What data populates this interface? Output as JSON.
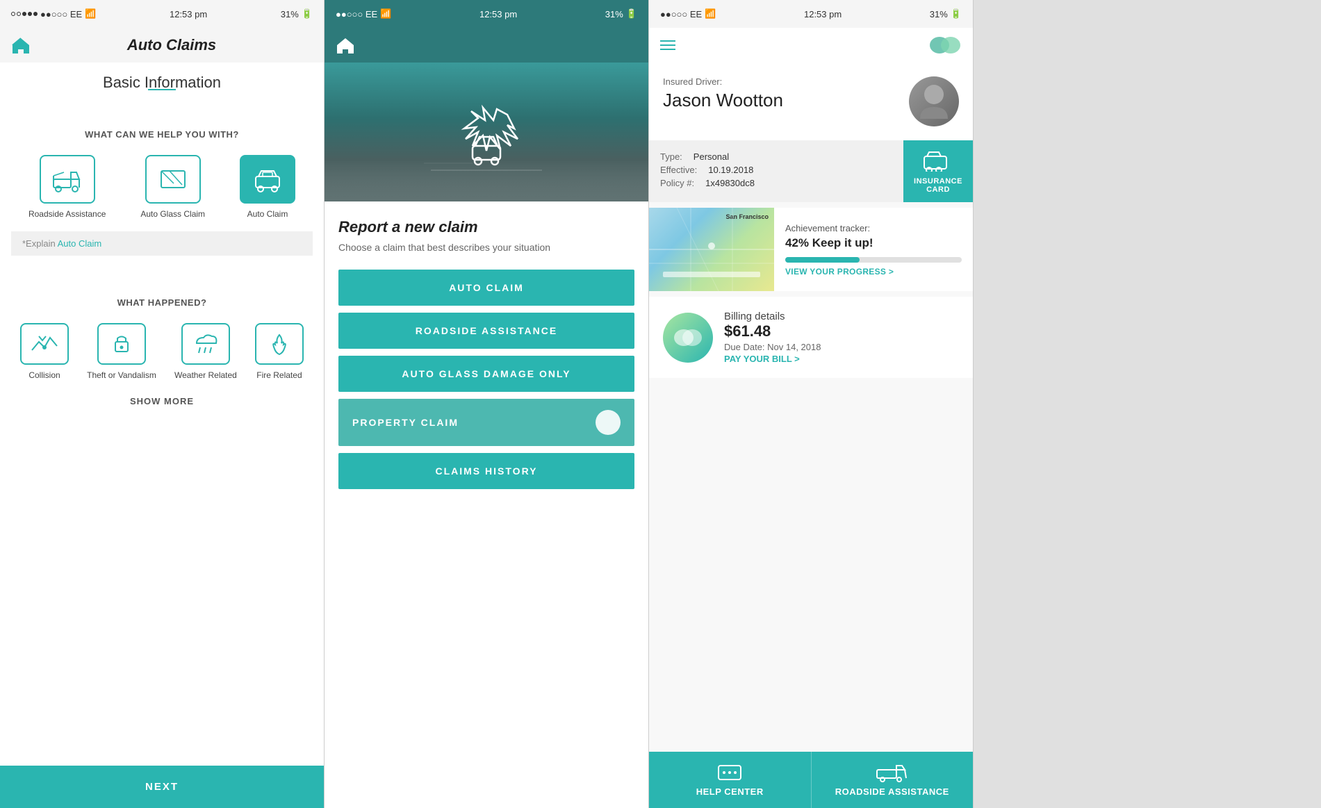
{
  "phones": [
    {
      "id": "phone1",
      "statusBar": {
        "left": "●●○○○ EE",
        "time": "12:53 pm",
        "right": "31%"
      },
      "navTitle": "Auto Claims",
      "basicInfoTitle": "Basic Information",
      "helpSection": {
        "title": "WHAT CAN WE HELP YOU WITH?",
        "options": [
          {
            "label": "Roadside Assistance",
            "active": false
          },
          {
            "label": "Auto Glass Claim",
            "active": false
          },
          {
            "label": "Auto Claim",
            "active": true
          }
        ]
      },
      "explainText": "*Explain ",
      "explainLink": "Auto Claim",
      "whatHappenedSection": {
        "title": "WHAT HAPPENED?",
        "options": [
          {
            "label": "Collision"
          },
          {
            "label": "Theft or Vandalism"
          },
          {
            "label": "Weather Related"
          },
          {
            "label": "Fire Related"
          }
        ]
      },
      "showMoreLabel": "SHOW MORE",
      "nextLabel": "NEXT"
    },
    {
      "id": "phone2",
      "statusBar": {
        "left": "●●○○○ EE",
        "time": "12:53 pm",
        "right": "31%"
      },
      "reportTitle": "Report a new claim",
      "reportSubtitle": "Choose a claim that best describes your situation",
      "claimButtons": [
        {
          "label": "AUTO CLAIM",
          "type": "normal"
        },
        {
          "label": "ROADSIDE ASSISTANCE",
          "type": "normal"
        },
        {
          "label": "AUTO GLASS DAMAGE ONLY",
          "type": "normal"
        },
        {
          "label": "PROPERTY CLAIM",
          "type": "toggle"
        },
        {
          "label": "CLAIMS HISTORY",
          "type": "normal"
        }
      ]
    },
    {
      "id": "phone3",
      "statusBar": {
        "left": "●●○○○ EE",
        "time": "12:53 pm",
        "right": "31%"
      },
      "profile": {
        "insuredLabel": "Insured Driver:",
        "driverName": "Jason Wootton"
      },
      "policy": {
        "typeLabel": "Type:",
        "typeValue": "Personal",
        "effectiveLabel": "Effective:",
        "effectiveValue": "10.19.2018",
        "policyLabel": "Policy #:",
        "policyValue": "1x49830dc8"
      },
      "insuranceCardLabel": "INSURANCE CARD",
      "achievement": {
        "title": "Achievement tracker:",
        "value": "42% Keep it up!",
        "progressPercent": 42,
        "viewProgressLabel": "VIEW YOUR PROGRESS >"
      },
      "map": {
        "label": "San Francisco"
      },
      "billing": {
        "title": "Billing details",
        "amount": "$61.48",
        "dueDate": "Due Date: Nov 14, 2018",
        "payLabel": "PAY YOUR BILL >"
      },
      "bottomNav": [
        {
          "label": "HELP CENTER"
        },
        {
          "label": "ROADSIDE ASSISTANCE"
        }
      ]
    }
  ]
}
